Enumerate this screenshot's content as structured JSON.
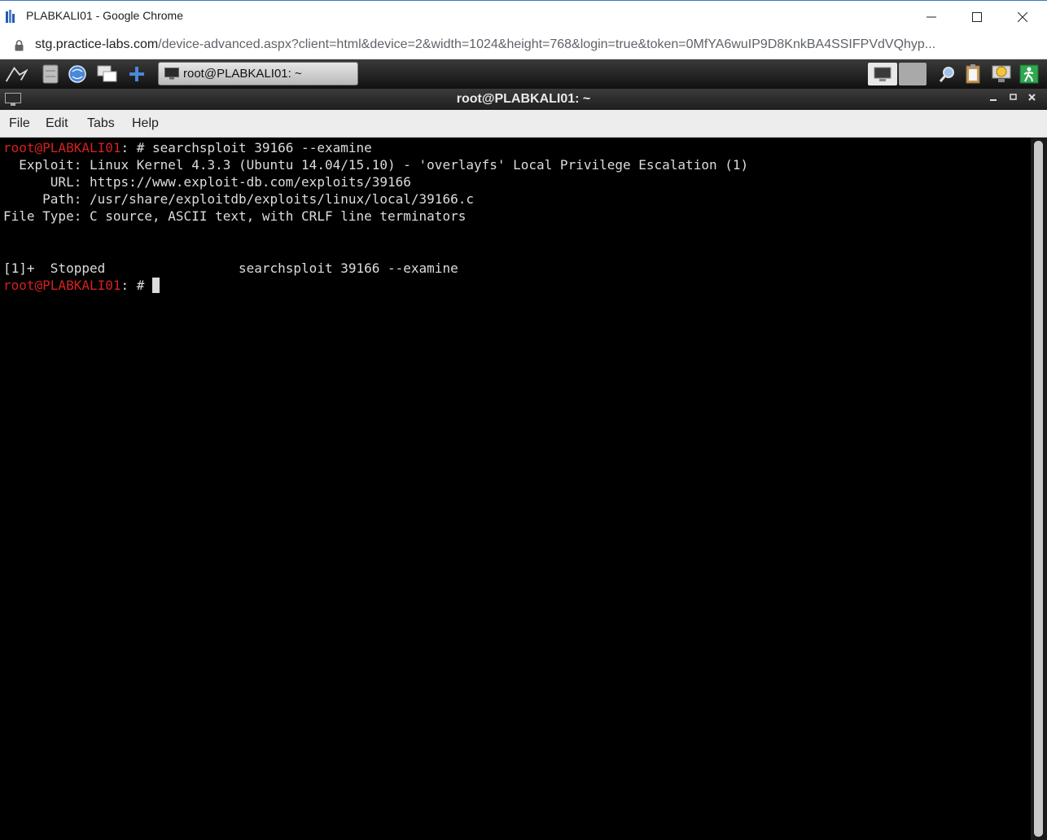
{
  "browser": {
    "window_title": "PLABKALI01 - Google Chrome",
    "url_host": "stg.practice-labs.com",
    "url_path": "/device-advanced.aspx?client=html&device=2&width=1024&height=768&login=true&token=0MfYA6wuIP9D8KnkBA4SSIFPVdVQhyp..."
  },
  "taskbar": {
    "active_task_label": "root@PLABKALI01: ~"
  },
  "terminal": {
    "title": "root@PLABKALI01: ~",
    "menu": [
      "File",
      "Edit",
      "Tabs",
      "Help"
    ],
    "prompt_user": "root@PLABKALI01",
    "prompt_suffix": ": # ",
    "lines": {
      "cmd": "searchsploit 39166 --examine",
      "exploit": "  Exploit: Linux Kernel 4.3.3 (Ubuntu 14.04/15.10) - 'overlayfs' Local Privilege Escalation (1)",
      "url": "      URL: https://www.exploit-db.com/exploits/39166",
      "path": "     Path: /usr/share/exploitdb/exploits/linux/local/39166.c",
      "filetype": "File Type: C source, ASCII text, with CRLF line terminators",
      "stopped": "[1]+  Stopped                 searchsploit 39166 --examine"
    }
  },
  "colors": {
    "prompt": "#d52020",
    "terminal_bg": "#000000",
    "terminal_fg": "#dcdcdc"
  }
}
